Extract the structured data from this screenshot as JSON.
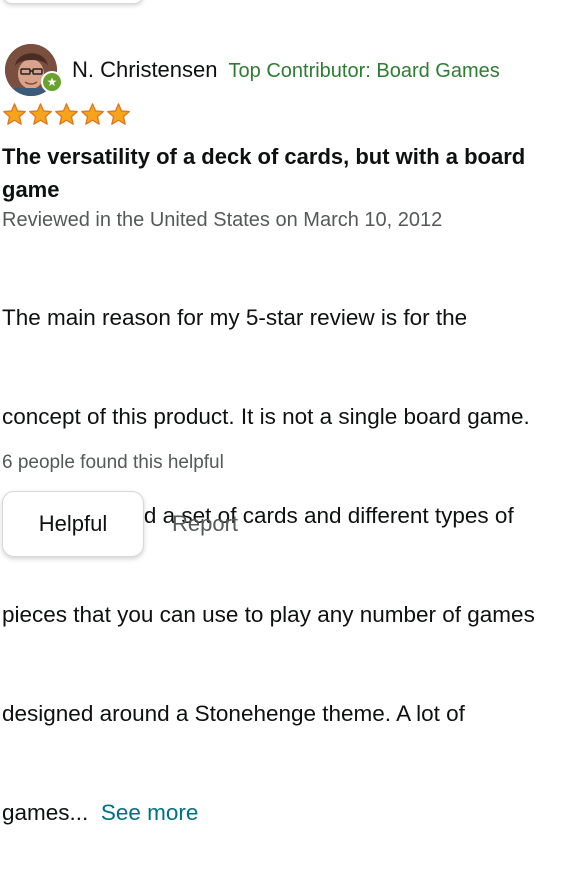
{
  "review": {
    "reviewer_name": "N. Christensen",
    "contributor_badge": "Top Contributor: Board Games",
    "avatar_icon": "avatar-photo",
    "badge_icon": "star-badge-icon",
    "rating": 5,
    "rating_max": 5,
    "title_lines": [
      "The versatility of a deck of cards, but with a board",
      "game"
    ],
    "meta": "Reviewed in the United States on March 10, 2012",
    "body_lines": [
      "The main reason for my 5-star review is for the",
      "concept of this product. It is not a single board game.",
      "It's a board and a set of cards and different types of",
      "pieces that you can use to play any number of games",
      "designed around a Stonehenge theme. A lot of"
    ],
    "body_last_line": "games...",
    "see_more": "See more",
    "helpful_count": "6 people found this helpful",
    "helpful_button": "Helpful",
    "report_button": "Report"
  },
  "colors": {
    "star": "#f7a41d",
    "star_outline": "#de7921",
    "contributor": "#2e7d32",
    "link": "#007185",
    "muted": "#565959",
    "badge": "#6aa22e"
  }
}
